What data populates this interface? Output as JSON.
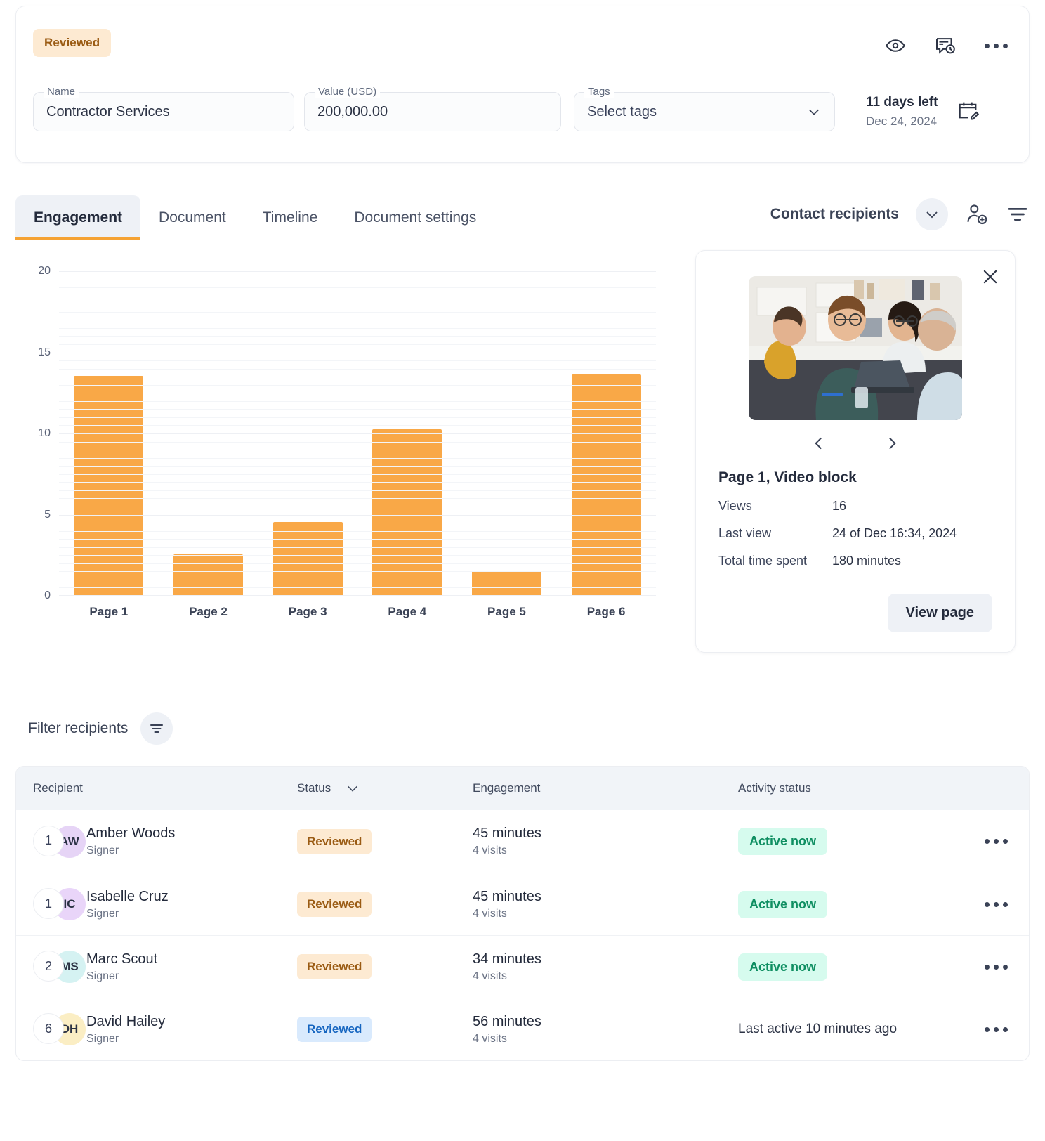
{
  "header": {
    "status_pill": "Reviewed",
    "icons": {
      "preview": "eye-icon",
      "comment_history": "comment-clock-icon",
      "more": "more-horizontal-icon"
    },
    "fields": {
      "name": {
        "label": "Name",
        "value": "Contractor Services"
      },
      "value_usd": {
        "label": "Value (USD)",
        "value": "200,000.00"
      },
      "tags": {
        "label": "Tags",
        "value": "Select tags"
      }
    },
    "due": {
      "days_left": "11 days left",
      "date": "Dec 24, 2024"
    }
  },
  "tabs": [
    {
      "label": "Engagement",
      "active": true
    },
    {
      "label": "Document",
      "active": false
    },
    {
      "label": "Timeline",
      "active": false
    },
    {
      "label": "Document settings",
      "active": false
    }
  ],
  "tabs_right": {
    "contact_recipients": "Contact recipients",
    "chevron": "chevron-down-icon",
    "add_recipient": "add-person-icon",
    "filter": "filter-icon"
  },
  "chart_data": {
    "type": "bar",
    "title": "",
    "xlabel": "",
    "ylabel": "",
    "categories": [
      "Page 1",
      "Page 2",
      "Page 3",
      "Page 4",
      "Page 5",
      "Page 6"
    ],
    "values": [
      13.5,
      2.5,
      4.5,
      10.2,
      1.5,
      13.6
    ],
    "ylim": [
      0,
      20
    ],
    "yticks": [
      0,
      5,
      10,
      15,
      20
    ],
    "ytick_labels": [
      "0",
      "5",
      "10",
      "15",
      "20"
    ],
    "grid": true,
    "minor_grid_step": 0.5,
    "bar_color": "#f9a847",
    "legend": null
  },
  "detail_card": {
    "close": "close-icon",
    "thumbnail_alt": "office-meeting-photo",
    "prev": "chevron-left-icon",
    "next": "chevron-right-icon",
    "title": "Page 1, Video block",
    "stats": [
      {
        "key": "Views",
        "value": "16"
      },
      {
        "key": "Last view",
        "value": "24 of Dec 16:34, 2024"
      },
      {
        "key": "Total time spent",
        "value": "180 minutes"
      }
    ],
    "view_page_label": "View page"
  },
  "filter": {
    "label": "Filter recipients",
    "icon": "filter-icon"
  },
  "table": {
    "columns": [
      "Recipient",
      "Status",
      "Engagement",
      "Activity status"
    ],
    "status_sort_icon": "chevron-down-icon",
    "row_menu_icon": "more-horizontal-icon",
    "rows": [
      {
        "order": "1",
        "initials": "AW",
        "avatar_color": "#e6d4f6",
        "name": "Amber Woods",
        "role": "Signer",
        "status": "Reviewed",
        "status_style": "orange",
        "engagement_time": "45 minutes",
        "visits": "4 visits",
        "activity": "Active now",
        "activity_style": "badge"
      },
      {
        "order": "1",
        "initials": "IC",
        "avatar_color": "#e9d5f9",
        "name": "Isabelle Cruz",
        "role": "Signer",
        "status": "Reviewed",
        "status_style": "orange",
        "engagement_time": "45 minutes",
        "visits": "4 visits",
        "activity": "Active now",
        "activity_style": "badge"
      },
      {
        "order": "2",
        "initials": "MS",
        "avatar_color": "#d5f2f2",
        "name": "Marc Scout",
        "role": "Signer",
        "status": "Reviewed",
        "status_style": "orange",
        "engagement_time": "34 minutes",
        "visits": "4 visits",
        "activity": "Active now",
        "activity_style": "badge"
      },
      {
        "order": "6",
        "initials": "DH",
        "avatar_color": "#fbeec4",
        "name": "David Hailey",
        "role": "Signer",
        "status": "Reviewed",
        "status_style": "blue",
        "engagement_time": "56 minutes",
        "visits": "4 visits",
        "activity": "Last active 10 minutes ago",
        "activity_style": "text"
      }
    ]
  }
}
